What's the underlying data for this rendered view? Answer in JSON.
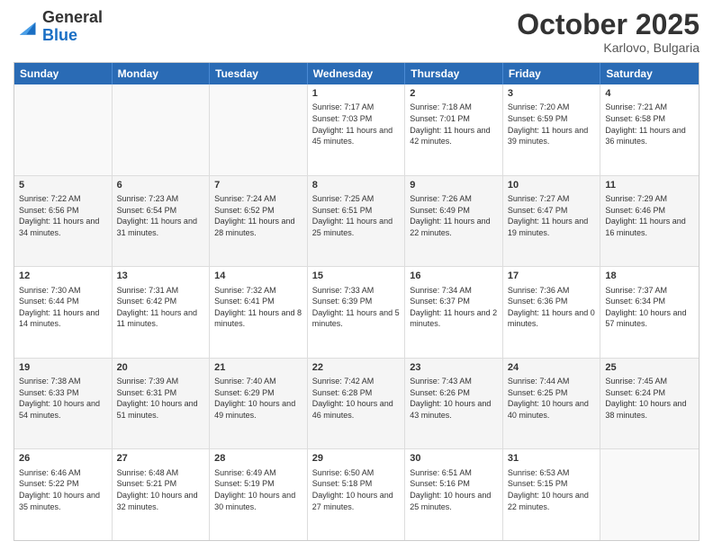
{
  "logo": {
    "general": "General",
    "blue": "Blue"
  },
  "title": "October 2025",
  "location": "Karlovo, Bulgaria",
  "days": [
    "Sunday",
    "Monday",
    "Tuesday",
    "Wednesday",
    "Thursday",
    "Friday",
    "Saturday"
  ],
  "rows": [
    {
      "shade": false,
      "cells": [
        {
          "day": "",
          "empty": true
        },
        {
          "day": "",
          "empty": true
        },
        {
          "day": "",
          "empty": true
        },
        {
          "day": "1",
          "sunrise": "7:17 AM",
          "sunset": "7:03 PM",
          "daylight": "11 hours and 45 minutes."
        },
        {
          "day": "2",
          "sunrise": "7:18 AM",
          "sunset": "7:01 PM",
          "daylight": "11 hours and 42 minutes."
        },
        {
          "day": "3",
          "sunrise": "7:20 AM",
          "sunset": "6:59 PM",
          "daylight": "11 hours and 39 minutes."
        },
        {
          "day": "4",
          "sunrise": "7:21 AM",
          "sunset": "6:58 PM",
          "daylight": "11 hours and 36 minutes."
        }
      ]
    },
    {
      "shade": true,
      "cells": [
        {
          "day": "5",
          "sunrise": "7:22 AM",
          "sunset": "6:56 PM",
          "daylight": "11 hours and 34 minutes."
        },
        {
          "day": "6",
          "sunrise": "7:23 AM",
          "sunset": "6:54 PM",
          "daylight": "11 hours and 31 minutes."
        },
        {
          "day": "7",
          "sunrise": "7:24 AM",
          "sunset": "6:52 PM",
          "daylight": "11 hours and 28 minutes."
        },
        {
          "day": "8",
          "sunrise": "7:25 AM",
          "sunset": "6:51 PM",
          "daylight": "11 hours and 25 minutes."
        },
        {
          "day": "9",
          "sunrise": "7:26 AM",
          "sunset": "6:49 PM",
          "daylight": "11 hours and 22 minutes."
        },
        {
          "day": "10",
          "sunrise": "7:27 AM",
          "sunset": "6:47 PM",
          "daylight": "11 hours and 19 minutes."
        },
        {
          "day": "11",
          "sunrise": "7:29 AM",
          "sunset": "6:46 PM",
          "daylight": "11 hours and 16 minutes."
        }
      ]
    },
    {
      "shade": false,
      "cells": [
        {
          "day": "12",
          "sunrise": "7:30 AM",
          "sunset": "6:44 PM",
          "daylight": "11 hours and 14 minutes."
        },
        {
          "day": "13",
          "sunrise": "7:31 AM",
          "sunset": "6:42 PM",
          "daylight": "11 hours and 11 minutes."
        },
        {
          "day": "14",
          "sunrise": "7:32 AM",
          "sunset": "6:41 PM",
          "daylight": "11 hours and 8 minutes."
        },
        {
          "day": "15",
          "sunrise": "7:33 AM",
          "sunset": "6:39 PM",
          "daylight": "11 hours and 5 minutes."
        },
        {
          "day": "16",
          "sunrise": "7:34 AM",
          "sunset": "6:37 PM",
          "daylight": "11 hours and 2 minutes."
        },
        {
          "day": "17",
          "sunrise": "7:36 AM",
          "sunset": "6:36 PM",
          "daylight": "11 hours and 0 minutes."
        },
        {
          "day": "18",
          "sunrise": "7:37 AM",
          "sunset": "6:34 PM",
          "daylight": "10 hours and 57 minutes."
        }
      ]
    },
    {
      "shade": true,
      "cells": [
        {
          "day": "19",
          "sunrise": "7:38 AM",
          "sunset": "6:33 PM",
          "daylight": "10 hours and 54 minutes."
        },
        {
          "day": "20",
          "sunrise": "7:39 AM",
          "sunset": "6:31 PM",
          "daylight": "10 hours and 51 minutes."
        },
        {
          "day": "21",
          "sunrise": "7:40 AM",
          "sunset": "6:29 PM",
          "daylight": "10 hours and 49 minutes."
        },
        {
          "day": "22",
          "sunrise": "7:42 AM",
          "sunset": "6:28 PM",
          "daylight": "10 hours and 46 minutes."
        },
        {
          "day": "23",
          "sunrise": "7:43 AM",
          "sunset": "6:26 PM",
          "daylight": "10 hours and 43 minutes."
        },
        {
          "day": "24",
          "sunrise": "7:44 AM",
          "sunset": "6:25 PM",
          "daylight": "10 hours and 40 minutes."
        },
        {
          "day": "25",
          "sunrise": "7:45 AM",
          "sunset": "6:24 PM",
          "daylight": "10 hours and 38 minutes."
        }
      ]
    },
    {
      "shade": false,
      "cells": [
        {
          "day": "26",
          "sunrise": "6:46 AM",
          "sunset": "5:22 PM",
          "daylight": "10 hours and 35 minutes."
        },
        {
          "day": "27",
          "sunrise": "6:48 AM",
          "sunset": "5:21 PM",
          "daylight": "10 hours and 32 minutes."
        },
        {
          "day": "28",
          "sunrise": "6:49 AM",
          "sunset": "5:19 PM",
          "daylight": "10 hours and 30 minutes."
        },
        {
          "day": "29",
          "sunrise": "6:50 AM",
          "sunset": "5:18 PM",
          "daylight": "10 hours and 27 minutes."
        },
        {
          "day": "30",
          "sunrise": "6:51 AM",
          "sunset": "5:16 PM",
          "daylight": "10 hours and 25 minutes."
        },
        {
          "day": "31",
          "sunrise": "6:53 AM",
          "sunset": "5:15 PM",
          "daylight": "10 hours and 22 minutes."
        },
        {
          "day": "",
          "empty": true
        }
      ]
    }
  ]
}
